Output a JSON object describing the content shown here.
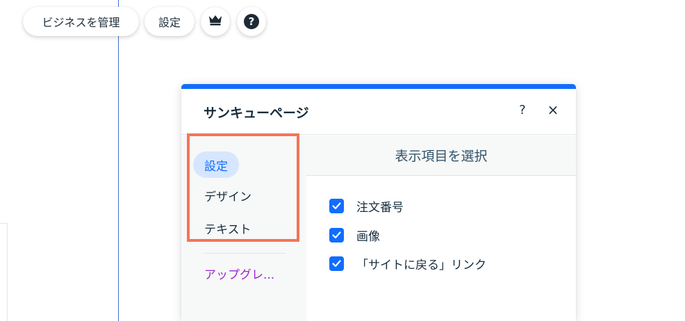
{
  "toolbar": {
    "manage_business_label": "ビジネスを管理",
    "settings_label": "設定",
    "crown_icon": "crown-icon",
    "help_icon": "help-icon",
    "help_glyph": "?"
  },
  "panel": {
    "title": "サンキューページ",
    "help_label": "?",
    "close_label": "×",
    "accent_color": "#116dff",
    "nav": {
      "items": [
        {
          "label": "設定",
          "active": true
        },
        {
          "label": "デザイン",
          "active": false
        },
        {
          "label": "テキスト",
          "active": false
        }
      ],
      "upgrade_label": "アップグレ..."
    },
    "section_title": "表示項目を選択",
    "options": [
      {
        "label": "注文番号",
        "checked": true
      },
      {
        "label": "画像",
        "checked": true
      },
      {
        "label": "「サイトに戻る」リンク",
        "checked": true
      }
    ]
  },
  "highlight_color": "#f47458"
}
